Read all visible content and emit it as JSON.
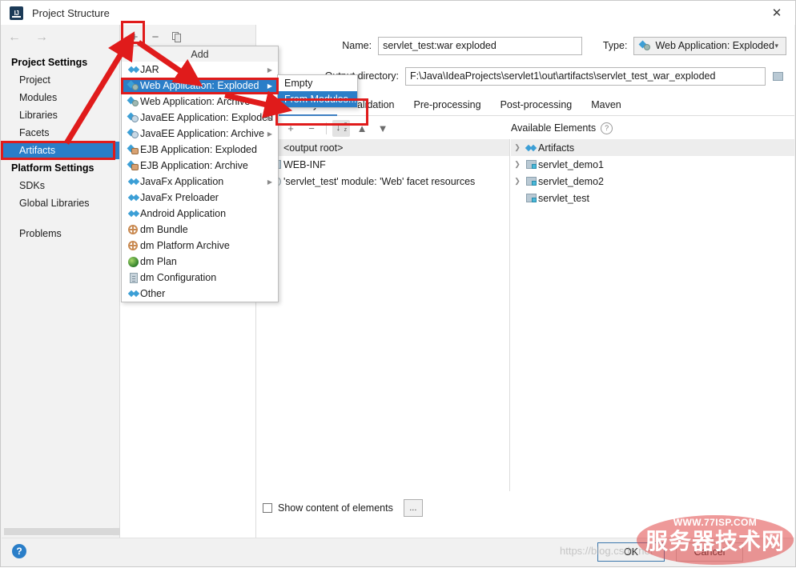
{
  "window": {
    "title": "Project Structure",
    "app_icon": "intellij-idea-icon",
    "close_label": "✕"
  },
  "sidebar": {
    "back_icon": "←",
    "forward_icon": "→",
    "groups": [
      {
        "label": "Project Settings",
        "items": [
          {
            "label": "Project",
            "selected": false
          },
          {
            "label": "Modules",
            "selected": false
          },
          {
            "label": "Libraries",
            "selected": false
          },
          {
            "label": "Facets",
            "selected": false
          },
          {
            "label": "Artifacts",
            "selected": true
          }
        ]
      },
      {
        "label": "Platform Settings",
        "items": [
          {
            "label": "SDKs",
            "selected": false
          },
          {
            "label": "Global Libraries",
            "selected": false
          }
        ]
      }
    ],
    "problems": "Problems"
  },
  "artifact_toolbar": {
    "add_label": "+",
    "remove_label": "−",
    "copy_label": "copy-icon"
  },
  "detail": {
    "name_label": "Name:",
    "name_value": "servlet_test:war exploded",
    "type_label": "Type:",
    "type_value": "Web Application: Exploded",
    "type_caret": "▾",
    "output_label": "Output directory:",
    "output_value": "F:\\Java\\IdeaProjects\\servlet1\\out\\artifacts\\servlet_test_war_exploded",
    "folder_icon": "folder-browse-icon",
    "tabs": [
      {
        "label": "Output Layout",
        "active": true
      },
      {
        "label": "Validation",
        "active": false
      },
      {
        "label": "Pre-processing",
        "active": false
      },
      {
        "label": "Post-processing",
        "active": false
      },
      {
        "label": "Maven",
        "active": false
      }
    ],
    "layout_toolbar": {
      "ruler_icon": "ruler-icon",
      "add_icon": "+",
      "remove_icon": "−",
      "sort_icon": "sort-az-icon",
      "up_icon": "▲",
      "down_icon": "▼"
    },
    "available_elements_label": "Available Elements",
    "help_hint": "?",
    "output_tree": [
      {
        "label": "<output root>",
        "indent": 0,
        "twisty": "",
        "icon": "none",
        "selected": true
      },
      {
        "label": "WEB-INF",
        "indent": 0,
        "twisty": "❯",
        "icon": "folder",
        "selected": false
      },
      {
        "label": "'servlet_test' module: 'Web' facet resources",
        "indent": 0,
        "twisty": "",
        "icon": "facet",
        "selected": false
      }
    ],
    "available_tree": [
      {
        "label": "Artifacts",
        "twisty": "❯",
        "icon": "artifact",
        "selected": true
      },
      {
        "label": "servlet_demo1",
        "twisty": "❯",
        "icon": "module",
        "selected": false
      },
      {
        "label": "servlet_demo2",
        "twisty": "❯",
        "icon": "module",
        "selected": false
      },
      {
        "label": "servlet_test",
        "twisty": "",
        "icon": "module",
        "selected": false
      }
    ],
    "show_content_label": "Show content of elements",
    "ellipsis_label": "..."
  },
  "add_menu": {
    "title": "Add",
    "items": [
      {
        "label": "JAR",
        "icon": "jar",
        "submenu": true,
        "selected": false
      },
      {
        "label": "Web Application: Exploded",
        "icon": "web",
        "submenu": true,
        "selected": true
      },
      {
        "label": "Web Application: Archive",
        "icon": "web",
        "submenu": true,
        "selected": false
      },
      {
        "label": "JavaEE Application: Exploded",
        "icon": "javaee",
        "submenu": true,
        "selected": false
      },
      {
        "label": "JavaEE Application: Archive",
        "icon": "javaee",
        "submenu": true,
        "selected": false
      },
      {
        "label": "EJB Application: Exploded",
        "icon": "ejb",
        "submenu": false,
        "selected": false
      },
      {
        "label": "EJB Application: Archive",
        "icon": "ejb",
        "submenu": false,
        "selected": false
      },
      {
        "label": "JavaFx Application",
        "icon": "jar",
        "submenu": true,
        "selected": false
      },
      {
        "label": "JavaFx Preloader",
        "icon": "jar",
        "submenu": false,
        "selected": false
      },
      {
        "label": "Android Application",
        "icon": "jar",
        "submenu": false,
        "selected": false
      },
      {
        "label": "dm Bundle",
        "icon": "dm",
        "submenu": false,
        "selected": false
      },
      {
        "label": "dm Platform Archive",
        "icon": "dm",
        "submenu": false,
        "selected": false
      },
      {
        "label": "dm Plan",
        "icon": "dmplan",
        "submenu": false,
        "selected": false
      },
      {
        "label": "dm Configuration",
        "icon": "dmcfg",
        "submenu": false,
        "selected": false
      },
      {
        "label": "Other",
        "icon": "jar",
        "submenu": false,
        "selected": false
      }
    ]
  },
  "sub_menu": {
    "items": [
      {
        "label": "Empty",
        "selected": false
      },
      {
        "label": "From Modules...",
        "selected": true
      }
    ]
  },
  "bottom": {
    "help_icon": "?",
    "ok_label": "OK",
    "cancel_label": "Cancel"
  },
  "watermark": {
    "url": "WWW.77ISP.COM",
    "text": "服务器技术网",
    "ghost": "https://blog.csdn.net"
  },
  "annotations": {
    "accent_red": "#e01b1b",
    "selection_blue": "#2a7ec8"
  }
}
